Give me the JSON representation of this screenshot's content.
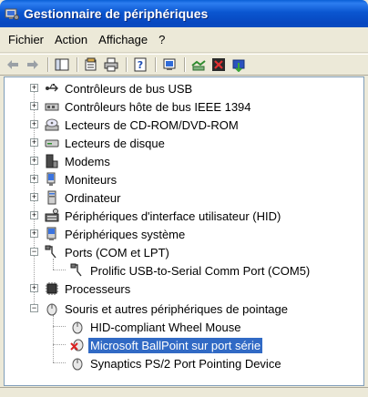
{
  "window": {
    "title": "Gestionnaire de périphériques"
  },
  "menu": {
    "items": [
      "Fichier",
      "Action",
      "Affichage",
      "?"
    ]
  },
  "toolbar": {
    "buttons": [
      "back-icon",
      "forward-icon",
      "show-hide-console-tree-icon",
      "properties-icon",
      "print-icon",
      "help-icon",
      "device-view-icon",
      "scan-hardware-icon",
      "uninstall-icon",
      "update-driver-icon"
    ]
  },
  "tree": {
    "categories": {
      "usb": "Contrôleurs de bus USB",
      "ieee1394": "Contrôleurs hôte de bus IEEE 1394",
      "cdrom": "Lecteurs de CD-ROM/DVD-ROM",
      "disk": "Lecteurs de disque",
      "modems": "Modems",
      "monitors": "Moniteurs",
      "computer": "Ordinateur",
      "hid": "Périphériques d'interface utilisateur (HID)",
      "system": "Périphériques système",
      "ports": "Ports (COM et LPT)",
      "processors": "Processeurs",
      "mice": "Souris et autres périphériques de pointage"
    },
    "devices": {
      "prolific": "Prolific USB-to-Serial Comm Port (COM5)",
      "hid_mouse": "HID-compliant Wheel Mouse",
      "ballpoint": "Microsoft BallPoint sur port série",
      "synaptics": "Synaptics PS/2 Port Pointing Device"
    },
    "selected": "Microsoft BallPoint sur port série",
    "expanded": [
      "Ports (COM et LPT)",
      "Souris et autres périphériques de pointage"
    ]
  }
}
